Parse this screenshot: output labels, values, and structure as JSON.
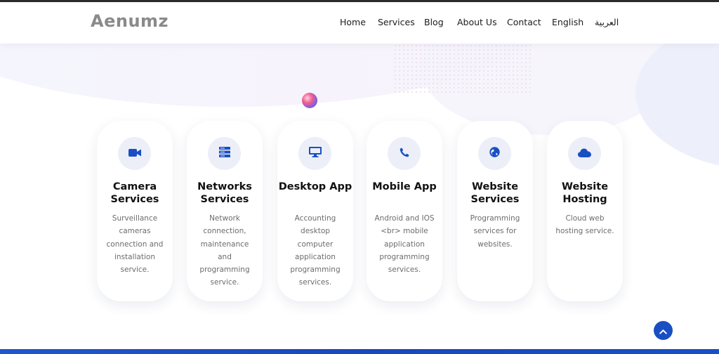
{
  "header": {
    "logo": "Aenumz",
    "nav": [
      {
        "label": "Home",
        "key": "home"
      },
      {
        "label": "Services",
        "key": "services"
      },
      {
        "label": "Blog",
        "key": "blog"
      },
      {
        "label": "About Us",
        "key": "about-us"
      },
      {
        "label": "Contact",
        "key": "contact"
      },
      {
        "label": "English",
        "key": "english"
      },
      {
        "label": "العربية",
        "key": "arabic"
      }
    ]
  },
  "services": [
    {
      "title": "Camera Services",
      "description": "Surveillance cameras connection and installation service.",
      "icon": "video-camera-icon"
    },
    {
      "title": "Networks Services",
      "description": "Network connection, maintenance and programming service.",
      "icon": "server-icon"
    },
    {
      "title": "Desktop App",
      "description": "Accounting desktop computer application programming services.",
      "icon": "desktop-icon"
    },
    {
      "title": "Mobile App",
      "description": "Android and IOS <br> mobile application programming services.",
      "icon": "phone-icon"
    },
    {
      "title": "Website Services",
      "description": "Programming services for websites.",
      "icon": "globe-icon"
    },
    {
      "title": "Website Hosting",
      "description": "Cloud web hosting service.",
      "icon": "cloud-icon"
    }
  ],
  "colors": {
    "accent": "#1a4fc4",
    "icon_bg": "#eceff8",
    "title_text": "#111111",
    "body_text": "#6c6c6c"
  },
  "scroll_top": {
    "icon": "chevron-up-icon"
  }
}
